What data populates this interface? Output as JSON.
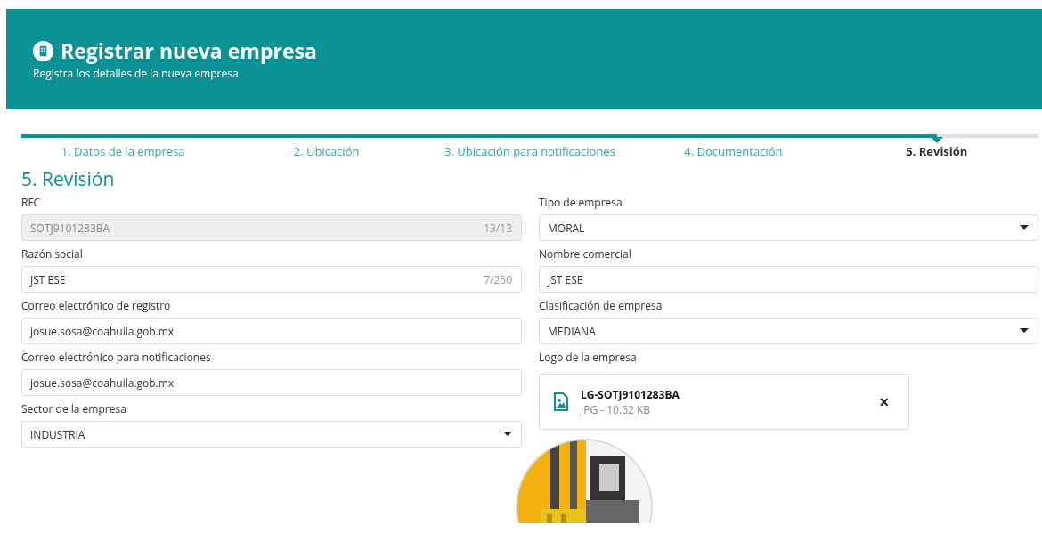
{
  "header": {
    "title": "Registrar nueva empresa",
    "subtitle": "Registra los detalles de la nueva empresa"
  },
  "steps": [
    {
      "label": "1. Datos de la empresa",
      "selected": false
    },
    {
      "label": "2. Ubicación",
      "selected": false
    },
    {
      "label": "3. Ubicación para notificaciones",
      "selected": false
    },
    {
      "label": "4. Documentación",
      "selected": false
    },
    {
      "label": "5. Revisión",
      "selected": true
    }
  ],
  "section_title": "5. Revisión",
  "left_fields": [
    {
      "label": "RFC",
      "kind": "text",
      "value": "SOTJ9101283BA",
      "counter": "13/13",
      "disabled": true
    },
    {
      "label": "Razón social",
      "kind": "text",
      "value": "JST ESE",
      "counter": "7/250",
      "disabled": false
    },
    {
      "label": "Correo electrónico de registro",
      "kind": "text",
      "value": "josue.sosa@coahuila.gob.mx",
      "disabled": false
    },
    {
      "label": "Correo electrónico para notificaciones",
      "kind": "text",
      "value": "josue.sosa@coahuila.gob.mx",
      "disabled": false
    },
    {
      "label": "Sector de la empresa",
      "kind": "select",
      "value": "INDUSTRIA",
      "disabled": false
    }
  ],
  "right_fields": [
    {
      "label": "Tipo de empresa",
      "kind": "select",
      "value": "MORAL",
      "disabled": false
    },
    {
      "label": "Nombre comercial",
      "kind": "text",
      "value": "JST ESE",
      "disabled": false
    },
    {
      "label": "Clasificación de empresa",
      "kind": "select",
      "value": "MEDIANA",
      "disabled": false
    }
  ],
  "logo": {
    "label": "Logo de la empresa",
    "file_name": "LG-SOTJ9101283BA",
    "file_info": "JPG - 10.62 KB",
    "remove": "×"
  }
}
